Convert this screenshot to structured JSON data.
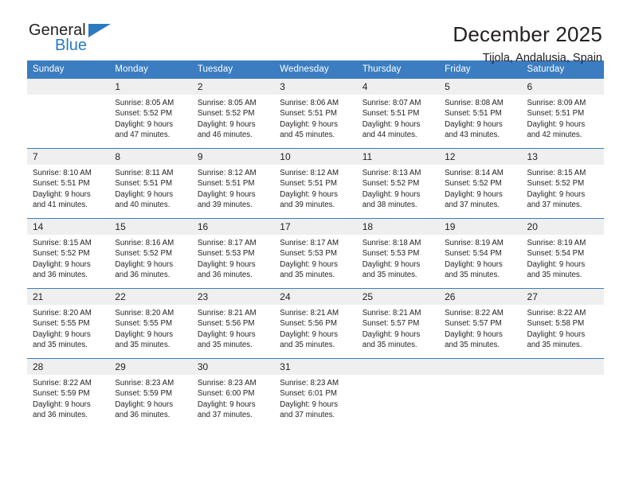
{
  "brand": {
    "name_part1": "General",
    "name_part2": "Blue",
    "accent_color": "#2a7ac0"
  },
  "header": {
    "title": "December 2025",
    "subtitle": "Tijola, Andalusia, Spain"
  },
  "calendar": {
    "header_bg": "#3b7dc0",
    "daynum_bg": "#efefef",
    "weekday_headers": [
      "Sunday",
      "Monday",
      "Tuesday",
      "Wednesday",
      "Thursday",
      "Friday",
      "Saturday"
    ],
    "weeks": [
      [
        {
          "day": "",
          "blank": true,
          "sunrise": "",
          "sunset": "",
          "daylight1": "",
          "daylight2": ""
        },
        {
          "day": "1",
          "sunrise": "Sunrise: 8:05 AM",
          "sunset": "Sunset: 5:52 PM",
          "daylight1": "Daylight: 9 hours",
          "daylight2": "and 47 minutes."
        },
        {
          "day": "2",
          "sunrise": "Sunrise: 8:05 AM",
          "sunset": "Sunset: 5:52 PM",
          "daylight1": "Daylight: 9 hours",
          "daylight2": "and 46 minutes."
        },
        {
          "day": "3",
          "sunrise": "Sunrise: 8:06 AM",
          "sunset": "Sunset: 5:51 PM",
          "daylight1": "Daylight: 9 hours",
          "daylight2": "and 45 minutes."
        },
        {
          "day": "4",
          "sunrise": "Sunrise: 8:07 AM",
          "sunset": "Sunset: 5:51 PM",
          "daylight1": "Daylight: 9 hours",
          "daylight2": "and 44 minutes."
        },
        {
          "day": "5",
          "sunrise": "Sunrise: 8:08 AM",
          "sunset": "Sunset: 5:51 PM",
          "daylight1": "Daylight: 9 hours",
          "daylight2": "and 43 minutes."
        },
        {
          "day": "6",
          "sunrise": "Sunrise: 8:09 AM",
          "sunset": "Sunset: 5:51 PM",
          "daylight1": "Daylight: 9 hours",
          "daylight2": "and 42 minutes."
        }
      ],
      [
        {
          "day": "7",
          "sunrise": "Sunrise: 8:10 AM",
          "sunset": "Sunset: 5:51 PM",
          "daylight1": "Daylight: 9 hours",
          "daylight2": "and 41 minutes."
        },
        {
          "day": "8",
          "sunrise": "Sunrise: 8:11 AM",
          "sunset": "Sunset: 5:51 PM",
          "daylight1": "Daylight: 9 hours",
          "daylight2": "and 40 minutes."
        },
        {
          "day": "9",
          "sunrise": "Sunrise: 8:12 AM",
          "sunset": "Sunset: 5:51 PM",
          "daylight1": "Daylight: 9 hours",
          "daylight2": "and 39 minutes."
        },
        {
          "day": "10",
          "sunrise": "Sunrise: 8:12 AM",
          "sunset": "Sunset: 5:51 PM",
          "daylight1": "Daylight: 9 hours",
          "daylight2": "and 39 minutes."
        },
        {
          "day": "11",
          "sunrise": "Sunrise: 8:13 AM",
          "sunset": "Sunset: 5:52 PM",
          "daylight1": "Daylight: 9 hours",
          "daylight2": "and 38 minutes."
        },
        {
          "day": "12",
          "sunrise": "Sunrise: 8:14 AM",
          "sunset": "Sunset: 5:52 PM",
          "daylight1": "Daylight: 9 hours",
          "daylight2": "and 37 minutes."
        },
        {
          "day": "13",
          "sunrise": "Sunrise: 8:15 AM",
          "sunset": "Sunset: 5:52 PM",
          "daylight1": "Daylight: 9 hours",
          "daylight2": "and 37 minutes."
        }
      ],
      [
        {
          "day": "14",
          "sunrise": "Sunrise: 8:15 AM",
          "sunset": "Sunset: 5:52 PM",
          "daylight1": "Daylight: 9 hours",
          "daylight2": "and 36 minutes."
        },
        {
          "day": "15",
          "sunrise": "Sunrise: 8:16 AM",
          "sunset": "Sunset: 5:52 PM",
          "daylight1": "Daylight: 9 hours",
          "daylight2": "and 36 minutes."
        },
        {
          "day": "16",
          "sunrise": "Sunrise: 8:17 AM",
          "sunset": "Sunset: 5:53 PM",
          "daylight1": "Daylight: 9 hours",
          "daylight2": "and 36 minutes."
        },
        {
          "day": "17",
          "sunrise": "Sunrise: 8:17 AM",
          "sunset": "Sunset: 5:53 PM",
          "daylight1": "Daylight: 9 hours",
          "daylight2": "and 35 minutes."
        },
        {
          "day": "18",
          "sunrise": "Sunrise: 8:18 AM",
          "sunset": "Sunset: 5:53 PM",
          "daylight1": "Daylight: 9 hours",
          "daylight2": "and 35 minutes."
        },
        {
          "day": "19",
          "sunrise": "Sunrise: 8:19 AM",
          "sunset": "Sunset: 5:54 PM",
          "daylight1": "Daylight: 9 hours",
          "daylight2": "and 35 minutes."
        },
        {
          "day": "20",
          "sunrise": "Sunrise: 8:19 AM",
          "sunset": "Sunset: 5:54 PM",
          "daylight1": "Daylight: 9 hours",
          "daylight2": "and 35 minutes."
        }
      ],
      [
        {
          "day": "21",
          "sunrise": "Sunrise: 8:20 AM",
          "sunset": "Sunset: 5:55 PM",
          "daylight1": "Daylight: 9 hours",
          "daylight2": "and 35 minutes."
        },
        {
          "day": "22",
          "sunrise": "Sunrise: 8:20 AM",
          "sunset": "Sunset: 5:55 PM",
          "daylight1": "Daylight: 9 hours",
          "daylight2": "and 35 minutes."
        },
        {
          "day": "23",
          "sunrise": "Sunrise: 8:21 AM",
          "sunset": "Sunset: 5:56 PM",
          "daylight1": "Daylight: 9 hours",
          "daylight2": "and 35 minutes."
        },
        {
          "day": "24",
          "sunrise": "Sunrise: 8:21 AM",
          "sunset": "Sunset: 5:56 PM",
          "daylight1": "Daylight: 9 hours",
          "daylight2": "and 35 minutes."
        },
        {
          "day": "25",
          "sunrise": "Sunrise: 8:21 AM",
          "sunset": "Sunset: 5:57 PM",
          "daylight1": "Daylight: 9 hours",
          "daylight2": "and 35 minutes."
        },
        {
          "day": "26",
          "sunrise": "Sunrise: 8:22 AM",
          "sunset": "Sunset: 5:57 PM",
          "daylight1": "Daylight: 9 hours",
          "daylight2": "and 35 minutes."
        },
        {
          "day": "27",
          "sunrise": "Sunrise: 8:22 AM",
          "sunset": "Sunset: 5:58 PM",
          "daylight1": "Daylight: 9 hours",
          "daylight2": "and 35 minutes."
        }
      ],
      [
        {
          "day": "28",
          "sunrise": "Sunrise: 8:22 AM",
          "sunset": "Sunset: 5:59 PM",
          "daylight1": "Daylight: 9 hours",
          "daylight2": "and 36 minutes."
        },
        {
          "day": "29",
          "sunrise": "Sunrise: 8:23 AM",
          "sunset": "Sunset: 5:59 PM",
          "daylight1": "Daylight: 9 hours",
          "daylight2": "and 36 minutes."
        },
        {
          "day": "30",
          "sunrise": "Sunrise: 8:23 AM",
          "sunset": "Sunset: 6:00 PM",
          "daylight1": "Daylight: 9 hours",
          "daylight2": "and 37 minutes."
        },
        {
          "day": "31",
          "sunrise": "Sunrise: 8:23 AM",
          "sunset": "Sunset: 6:01 PM",
          "daylight1": "Daylight: 9 hours",
          "daylight2": "and 37 minutes."
        },
        {
          "day": "",
          "blank": true,
          "sunrise": "",
          "sunset": "",
          "daylight1": "",
          "daylight2": ""
        },
        {
          "day": "",
          "blank": true,
          "sunrise": "",
          "sunset": "",
          "daylight1": "",
          "daylight2": ""
        },
        {
          "day": "",
          "blank": true,
          "sunrise": "",
          "sunset": "",
          "daylight1": "",
          "daylight2": ""
        }
      ]
    ]
  }
}
